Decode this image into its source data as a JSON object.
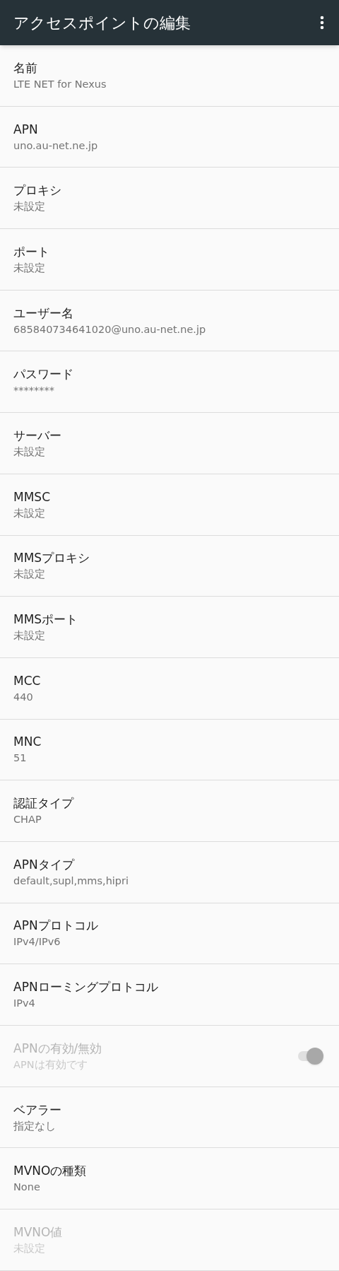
{
  "app_bar": {
    "title": "アクセスポイントの編集"
  },
  "rows": [
    {
      "kind": "text",
      "title": "名前",
      "summary": "LTE NET for Nexus",
      "disabled": false
    },
    {
      "kind": "text",
      "title": "APN",
      "summary": "uno.au-net.ne.jp",
      "disabled": false
    },
    {
      "kind": "text",
      "title": "プロキシ",
      "summary": "未設定",
      "disabled": false
    },
    {
      "kind": "text",
      "title": "ポート",
      "summary": "未設定",
      "disabled": false
    },
    {
      "kind": "text",
      "title": "ユーザー名",
      "summary": "685840734641020@uno.au-net.ne.jp",
      "disabled": false
    },
    {
      "kind": "text",
      "title": "パスワード",
      "summary": "********",
      "disabled": false
    },
    {
      "kind": "text",
      "title": "サーバー",
      "summary": "未設定",
      "disabled": false
    },
    {
      "kind": "text",
      "title": "MMSC",
      "summary": "未設定",
      "disabled": false
    },
    {
      "kind": "text",
      "title": "MMSプロキシ",
      "summary": "未設定",
      "disabled": false
    },
    {
      "kind": "text",
      "title": "MMSポート",
      "summary": "未設定",
      "disabled": false
    },
    {
      "kind": "text",
      "title": "MCC",
      "summary": "440",
      "disabled": false
    },
    {
      "kind": "text",
      "title": "MNC",
      "summary": "51",
      "disabled": false
    },
    {
      "kind": "text",
      "title": "認証タイプ",
      "summary": "CHAP",
      "disabled": false
    },
    {
      "kind": "text",
      "title": "APNタイプ",
      "summary": "default,supl,mms,hipri",
      "disabled": false
    },
    {
      "kind": "text",
      "title": "APNプロトコル",
      "summary": "IPv4/IPv6",
      "disabled": false
    },
    {
      "kind": "text",
      "title": "APNローミングプロトコル",
      "summary": "IPv4",
      "disabled": false
    },
    {
      "kind": "switch",
      "title": "APNの有効/無効",
      "summary": "APNは有効です",
      "disabled": true,
      "on": true
    },
    {
      "kind": "text",
      "title": "ベアラー",
      "summary": "指定なし",
      "disabled": false
    },
    {
      "kind": "text",
      "title": "MVNOの種類",
      "summary": "None",
      "disabled": false
    },
    {
      "kind": "text",
      "title": "MVNO値",
      "summary": "未設定",
      "disabled": true
    }
  ]
}
